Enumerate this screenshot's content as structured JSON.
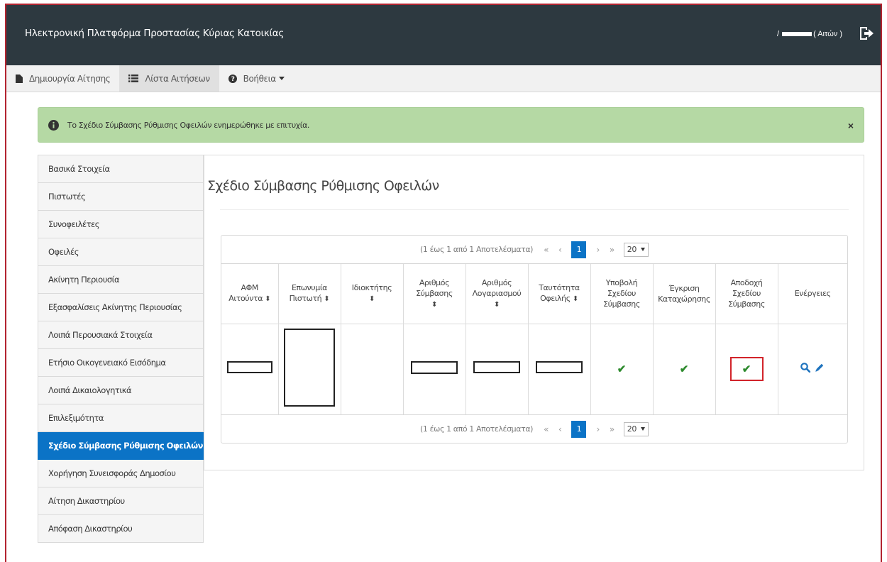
{
  "header": {
    "title": "Ηλεκτρονική Πλατφόρμα Προστασίας Κύριας Κατοικίας",
    "user_prefix": "/",
    "user_role": "( Αιτών )"
  },
  "nav": {
    "create": "Δημιουργία Αίτησης",
    "list": "Λίστα Αιτήσεων",
    "help": "Βοήθεια"
  },
  "alert": {
    "message": "Το Σχέδιο Σύμβασης Ρύθμισης Οφειλών ενημερώθηκε με επιτυχία.",
    "close": "×"
  },
  "sidebar": {
    "items": [
      {
        "label": "Βασικά Στοιχεία"
      },
      {
        "label": "Πιστωτές"
      },
      {
        "label": "Συνοφειλέτες"
      },
      {
        "label": "Οφειλές"
      },
      {
        "label": "Ακίνητη Περιουσία"
      },
      {
        "label": "Εξασφαλίσεις Ακίνητης Περιουσίας"
      },
      {
        "label": "Λοιπά Περουσιακά Στοιχεία"
      },
      {
        "label": "Ετήσιο Οικογενειακό Εισόδημα"
      },
      {
        "label": "Λοιπά Δικαιολογητικά"
      },
      {
        "label": "Επιλεξιμότητα"
      },
      {
        "label": "Σχέδιο Σύμβασης Ρύθμισης Οφειλών"
      },
      {
        "label": "Χορήγηση Συνεισφοράς Δημοσίου"
      },
      {
        "label": "Αίτηση Δικαστηρίου"
      },
      {
        "label": "Απόφαση Δικαστηρίου"
      }
    ],
    "active_index": 10
  },
  "panel": {
    "title": "Σχέδιο Σύμβασης Ρύθμισης Οφειλών"
  },
  "pager": {
    "info": "(1 έως 1 από 1 Αποτελέσματα)",
    "first": "«",
    "prev": "‹",
    "current": "1",
    "next": "›",
    "last": "»",
    "page_size": "20"
  },
  "table": {
    "headers": {
      "afm_line1": "ΑΦΜ",
      "afm_line2": "Αιτούντα",
      "name_line1": "Επωνυμία",
      "name_line2": "Πιστωτή",
      "owner": "Ιδιοκτήτης",
      "contract_line1": "Αριθμός",
      "contract_line2": "Σύμβασης",
      "account_line1": "Αριθμός",
      "account_line2": "Λογαριασμού",
      "debt_line1": "Ταυτότητα",
      "debt_line2": "Οφειλής",
      "submit_line1": "Υποβολή",
      "submit_line2": "Σχεδίου",
      "submit_line3": "Σύμβασης",
      "approve_line1": "Έγκριση",
      "approve_line2": "Καταχώρησης",
      "accept_line1": "Αποδοχή",
      "accept_line2": "Σχεδίου",
      "accept_line3": "Σύμβασης",
      "actions": "Ενέργειες"
    },
    "sort_icon": "⬍",
    "check": "✔"
  }
}
